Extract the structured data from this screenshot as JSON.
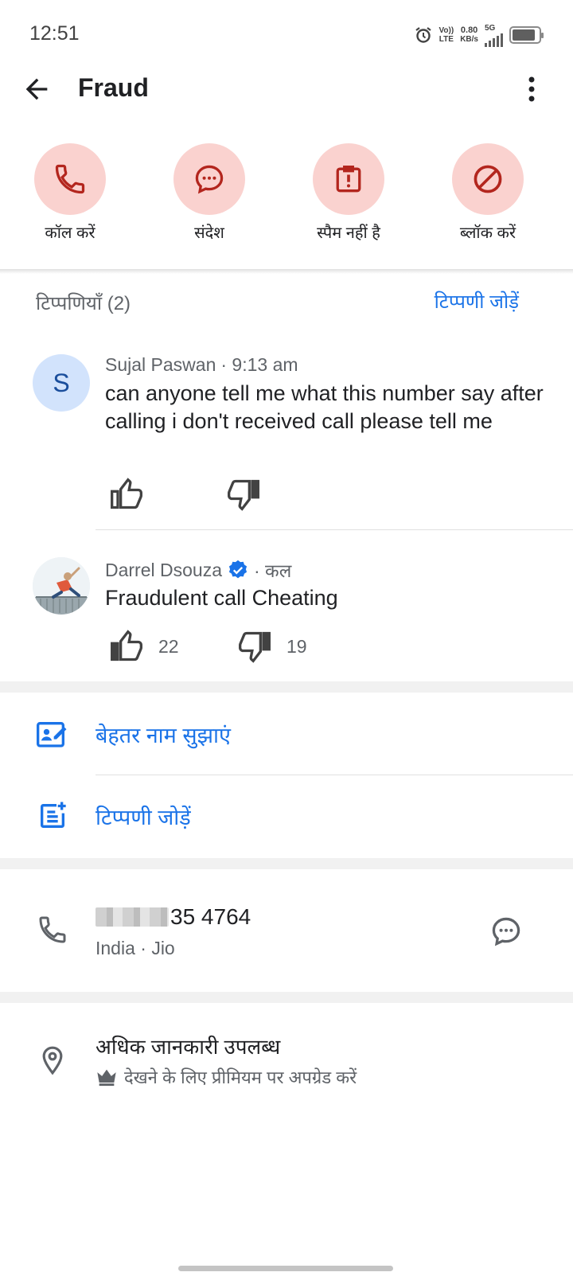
{
  "status_bar": {
    "time": "12:51",
    "volte_top": "Vo))",
    "volte_bottom": "LTE",
    "speed_value": "0.80",
    "speed_unit": "KB/s",
    "network": "5G"
  },
  "app_bar": {
    "title": "Fraud",
    "back_icon": "arrow-back-icon",
    "more_icon": "more-vert-icon"
  },
  "actions": [
    {
      "label": "कॉल करें",
      "icon": "phone-icon"
    },
    {
      "label": "संदेश",
      "icon": "message-icon"
    },
    {
      "label": "स्पैम नहीं है",
      "icon": "report-icon"
    },
    {
      "label": "ब्लॉक करें",
      "icon": "block-icon"
    }
  ],
  "comments": {
    "header": "टिप्पणियाँ (2)",
    "add_link": "टिप्पणी जोड़ें",
    "items": [
      {
        "avatar_letter": "S",
        "author": "Sujal Paswan",
        "time": "· 9:13 am",
        "text": "can anyone tell me what this number say after calling i don't received call please tell me",
        "likes": "",
        "dislikes": ""
      },
      {
        "author": "Darrel Dsouza",
        "time": "· कल",
        "text": "Fraudulent call Cheating",
        "likes": "22",
        "dislikes": "19"
      }
    ]
  },
  "suggestions": {
    "suggest_name": "बेहतर नाम सुझाएं",
    "add_comment": "टिप्पणी जोड़ें"
  },
  "contact": {
    "number_visible": "35 4764",
    "location": "India · Jio"
  },
  "more_info": {
    "title": "अधिक जानकारी उपलब्ध",
    "upgrade_text": "देखने के लिए प्रीमियम पर अपग्रेड करें"
  },
  "colors": {
    "accent": "#1a73e8",
    "action_bg": "#fad2cf",
    "action_icon": "#b3261e"
  }
}
